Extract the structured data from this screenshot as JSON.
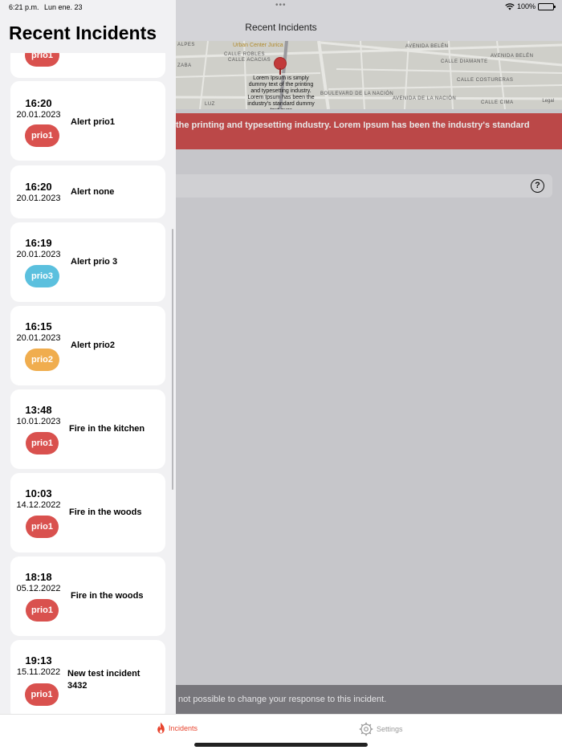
{
  "status_bar": {
    "time": "6:21 p.m.",
    "date": "Lun ene. 23",
    "battery": "100%",
    "icons": [
      "wifi-icon",
      "battery-icon"
    ]
  },
  "main": {
    "nav_title": "Recent Incidents",
    "map": {
      "poi": "Urban Center Jurica",
      "labels": [
        "AVENIDA BELÉN",
        "CALLE DIAMANTE",
        "AVENIDA BELÉN",
        "CALLE COSTURERAS",
        "BOULEVARD DE LA NACIÓN",
        "AVENIDA DE LA NACIÓN",
        "CALLE CIMA",
        "CALLE ROBLES",
        "CALLE ACACIAS",
        "ALPES",
        "ZABA",
        "LUZ"
      ],
      "popup": "Lorem Ipsum is simply dummy text of the printing and typesetting industry. Lorem Ipsum has been the industry's standard dummy text ever",
      "legal": "Legal"
    },
    "alert_banner": "the printing and typesetting industry. Lorem Ipsum has been the industry's standard",
    "help_label": "?",
    "response_notice": "not possible to change your response to this incident."
  },
  "drawer": {
    "title": "Recent Incidents",
    "partial_badge": "prio1",
    "incidents": [
      {
        "time": "16:20",
        "date": "20.01.2023",
        "title": "Alert prio1",
        "priority": "prio1"
      },
      {
        "time": "16:20",
        "date": "20.01.2023",
        "title": "Alert none",
        "priority": ""
      },
      {
        "time": "16:19",
        "date": "20.01.2023",
        "title": "Alert prio 3",
        "priority": "prio3"
      },
      {
        "time": "16:15",
        "date": "20.01.2023",
        "title": "Alert prio2",
        "priority": "prio2"
      },
      {
        "time": "13:48",
        "date": "10.01.2023",
        "title": "Fire in the kitchen",
        "priority": "prio1"
      },
      {
        "time": "10:03",
        "date": "14.12.2022",
        "title": "Fire in the woods",
        "priority": "prio1"
      },
      {
        "time": "18:18",
        "date": "05.12.2022",
        "title": "Fire in the woods",
        "priority": "prio1"
      },
      {
        "time": "19:13",
        "date": "15.11.2022",
        "title": "New test incident 3432",
        "priority": "prio1"
      }
    ]
  },
  "tabs": [
    {
      "label": "Incidents",
      "icon": "flame-icon",
      "active": true
    },
    {
      "label": "Settings",
      "icon": "gear-icon",
      "active": false
    }
  ],
  "colors": {
    "prio1": "#d9514e",
    "prio2": "#f0ad4e",
    "prio3": "#5bc0de",
    "accent": "#e8442e",
    "banner": "#bb4848"
  }
}
